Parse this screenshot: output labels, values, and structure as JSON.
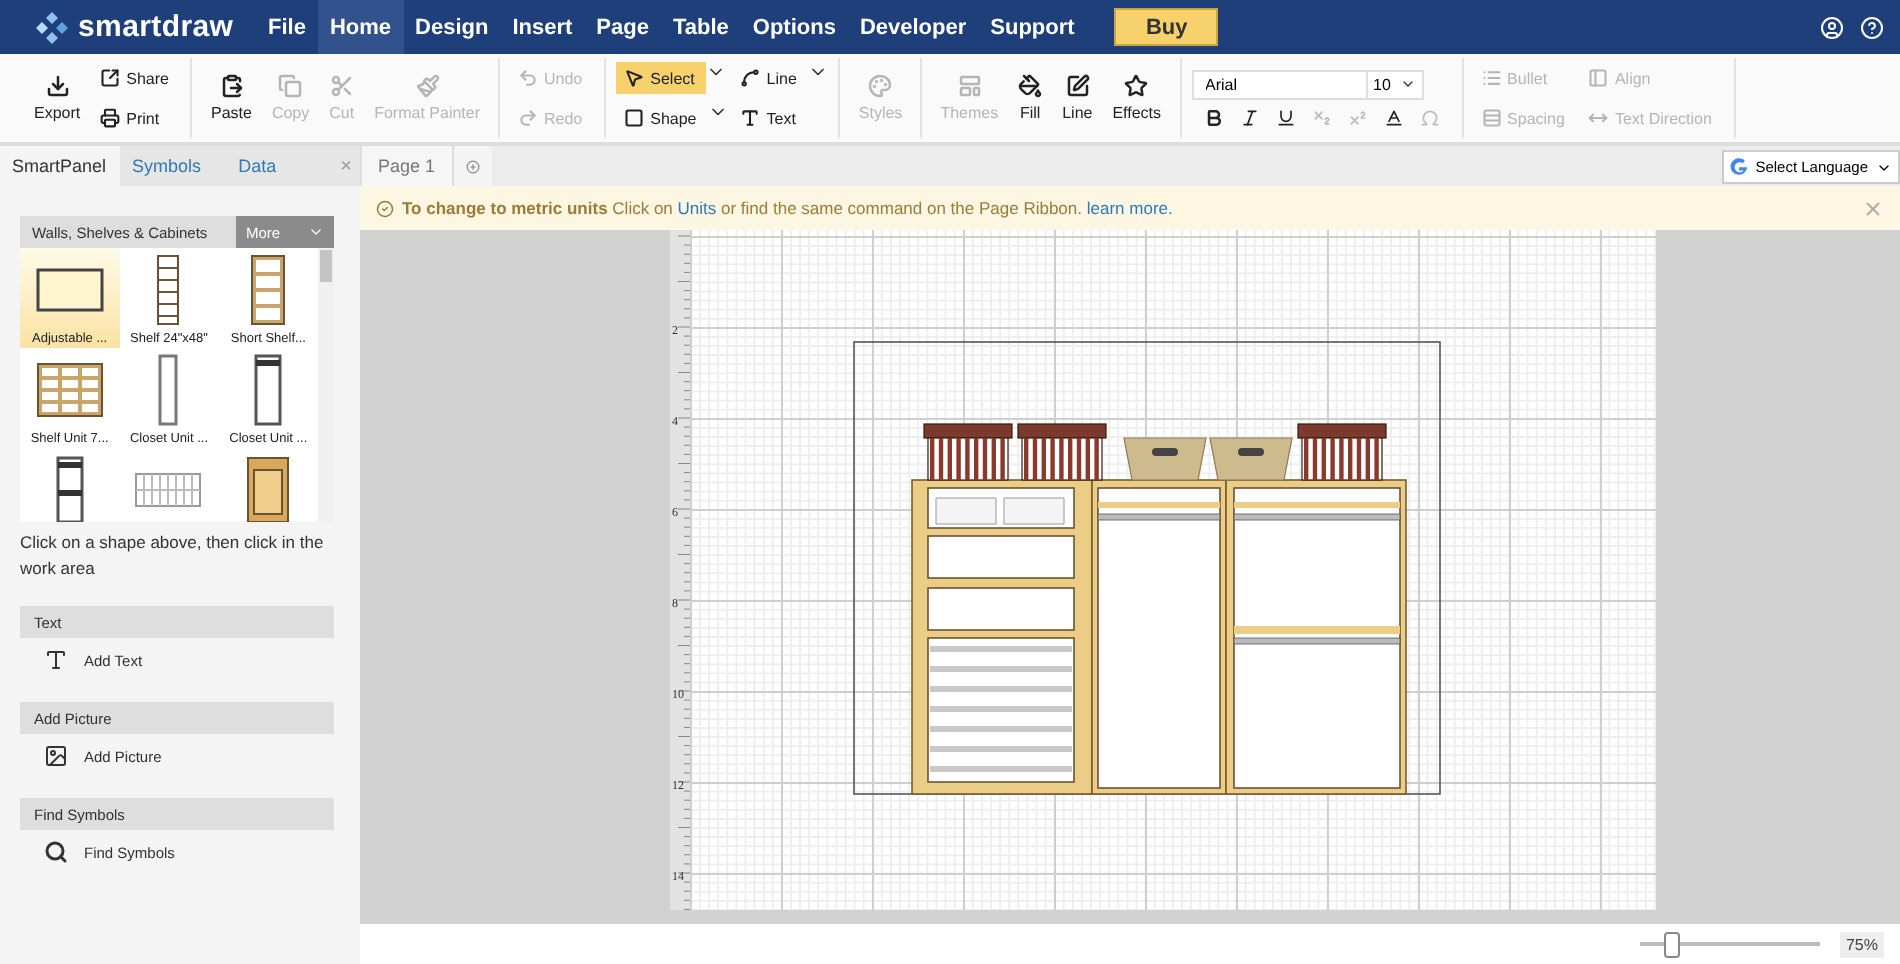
{
  "app": {
    "logo": "smartdraw"
  },
  "menu": [
    {
      "label": "File",
      "selected": false
    },
    {
      "label": "Home",
      "selected": true
    },
    {
      "label": "Design",
      "selected": false
    },
    {
      "label": "Insert",
      "selected": false
    },
    {
      "label": "Page",
      "selected": false
    },
    {
      "label": "Table",
      "selected": false
    },
    {
      "label": "Options",
      "selected": false
    },
    {
      "label": "Developer",
      "selected": false
    },
    {
      "label": "Support",
      "selected": false
    }
  ],
  "buy_button": "Buy",
  "ribbon": {
    "export": {
      "label": "Export",
      "disabled": false
    },
    "share": {
      "label": "Share",
      "disabled": false
    },
    "print": {
      "label": "Print",
      "disabled": false
    },
    "paste": {
      "label": "Paste",
      "disabled": false
    },
    "copy": {
      "label": "Copy",
      "disabled": true
    },
    "cut": {
      "label": "Cut",
      "disabled": true
    },
    "format_painter": {
      "label": "Format Painter",
      "disabled": true
    },
    "undo": {
      "label": "Undo",
      "disabled": true
    },
    "redo": {
      "label": "Redo",
      "disabled": true
    },
    "select": {
      "label": "Select",
      "selected": true
    },
    "shape": {
      "label": "Shape",
      "selected": false
    },
    "line_tool": {
      "label": "Line",
      "selected": false
    },
    "text_tool": {
      "label": "Text",
      "selected": false
    },
    "styles": {
      "label": "Styles",
      "disabled": true
    },
    "themes": {
      "label": "Themes",
      "disabled": true
    },
    "fill": {
      "label": "Fill",
      "disabled": false
    },
    "line": {
      "label": "Line",
      "disabled": false
    },
    "effects": {
      "label": "Effects",
      "disabled": false
    },
    "font": "Arial",
    "font_size": "10",
    "bullet": {
      "label": "Bullet",
      "disabled": true
    },
    "align": {
      "label": "Align",
      "disabled": true
    },
    "spacing": {
      "label": "Spacing",
      "disabled": true
    },
    "text_direction": {
      "label": "Text Direction",
      "disabled": true
    }
  },
  "panel": {
    "tabs": [
      {
        "label": "SmartPanel",
        "selected": true
      },
      {
        "label": "Symbols",
        "selected": false
      },
      {
        "label": "Data",
        "selected": false
      }
    ],
    "close": "×",
    "library": "Walls, Shelves & Cabinets",
    "more": "More",
    "shapes": [
      {
        "label": "Adjustable ...",
        "kind": "panel",
        "selected": true
      },
      {
        "label": "Shelf 24\"x48\"",
        "kind": "ladder",
        "selected": false
      },
      {
        "label": "Short Shelf...",
        "kind": "shelf",
        "selected": false
      },
      {
        "label": "Shelf Unit 7...",
        "kind": "cubby",
        "selected": false
      },
      {
        "label": "Closet Unit ...",
        "kind": "closet",
        "selected": false
      },
      {
        "label": "Closet Unit ...",
        "kind": "closet-top",
        "selected": false
      },
      {
        "kind": "closet-double",
        "selected": false
      },
      {
        "kind": "wire",
        "selected": false
      },
      {
        "kind": "cabinet",
        "selected": false
      }
    ],
    "hint": "Click on a shape above, then click in the work area",
    "sections": [
      {
        "title": "Text",
        "action": "Add Text",
        "kind": "text"
      },
      {
        "title": "Add Picture",
        "action": "Add Picture",
        "kind": "picture"
      },
      {
        "title": "Find Symbols",
        "action": "Find Symbols",
        "kind": "search"
      }
    ]
  },
  "page_tabs": [
    {
      "label": "Page 1",
      "selected": true
    }
  ],
  "language": "Select Language",
  "notice": {
    "title": "To change to metric units",
    "text_1": "Click on ",
    "link_1": "Units",
    "text_2": " or find the same command on the Page Ribbon. ",
    "link_2": "learn more."
  },
  "ruler": [
    "2",
    "4",
    "6",
    "8",
    "10",
    "12",
    "14"
  ],
  "status": {
    "zoom": {
      "level": 0.18
    },
    "zoom_label": "75%"
  }
}
